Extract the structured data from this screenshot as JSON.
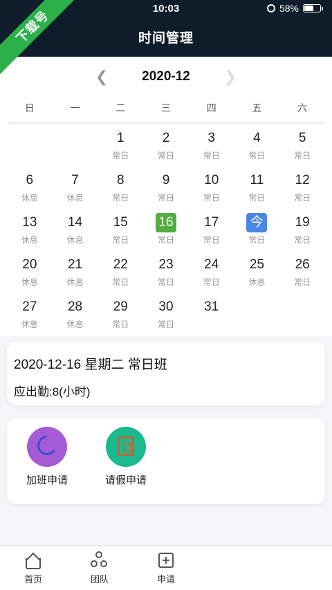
{
  "status": {
    "time": "10:03",
    "battery": "58%",
    "battery_level": 0.58
  },
  "header": {
    "title": "时间管理"
  },
  "watermark": {
    "text": "下载号"
  },
  "calendar": {
    "month": "2020-12",
    "weekdays": [
      "日",
      "一",
      "二",
      "三",
      "四",
      "五",
      "六"
    ],
    "leading_blanks": 2,
    "days": [
      {
        "d": "1",
        "t": "常日"
      },
      {
        "d": "2",
        "t": "常日"
      },
      {
        "d": "3",
        "t": "常日"
      },
      {
        "d": "4",
        "t": "常日"
      },
      {
        "d": "5",
        "t": "常日"
      },
      {
        "d": "6",
        "t": "休息"
      },
      {
        "d": "7",
        "t": "休息"
      },
      {
        "d": "8",
        "t": "常日"
      },
      {
        "d": "9",
        "t": "常日"
      },
      {
        "d": "10",
        "t": "常日"
      },
      {
        "d": "11",
        "t": "常日"
      },
      {
        "d": "12",
        "t": "常日"
      },
      {
        "d": "13",
        "t": "休息"
      },
      {
        "d": "14",
        "t": "休息"
      },
      {
        "d": "15",
        "t": "常日"
      },
      {
        "d": "16",
        "t": "常日",
        "selected": true
      },
      {
        "d": "17",
        "t": "常日"
      },
      {
        "d": "今",
        "t": "常日",
        "today": true
      },
      {
        "d": "19",
        "t": "常日"
      },
      {
        "d": "20",
        "t": "休息"
      },
      {
        "d": "21",
        "t": "休息"
      },
      {
        "d": "22",
        "t": "常日"
      },
      {
        "d": "23",
        "t": "常日"
      },
      {
        "d": "24",
        "t": "常日"
      },
      {
        "d": "25",
        "t": "休息"
      },
      {
        "d": "26",
        "t": "常日"
      },
      {
        "d": "27",
        "t": "休息"
      },
      {
        "d": "28",
        "t": "休息"
      },
      {
        "d": "29",
        "t": "常日"
      },
      {
        "d": "30",
        "t": "常日"
      },
      {
        "d": "31",
        "t": ""
      }
    ]
  },
  "info": {
    "line1": "2020-12-16 星期二 常日班",
    "line2": "应出勤:8(小时)"
  },
  "actions": [
    {
      "label": "加班申请",
      "icon": "moon-icon",
      "color": "#a55ad6"
    },
    {
      "label": "请假申请",
      "icon": "briefcase-icon",
      "color": "#1db98e"
    }
  ],
  "tabs": [
    {
      "label": "首页",
      "icon": "home-icon"
    },
    {
      "label": "团队",
      "icon": "team-icon"
    },
    {
      "label": "申请",
      "icon": "add-box-icon"
    }
  ],
  "colors": {
    "header_bg": "#0f1d2b",
    "selected": "#54ad3e",
    "today": "#4a87e2",
    "ribbon": "#2bb04a"
  }
}
